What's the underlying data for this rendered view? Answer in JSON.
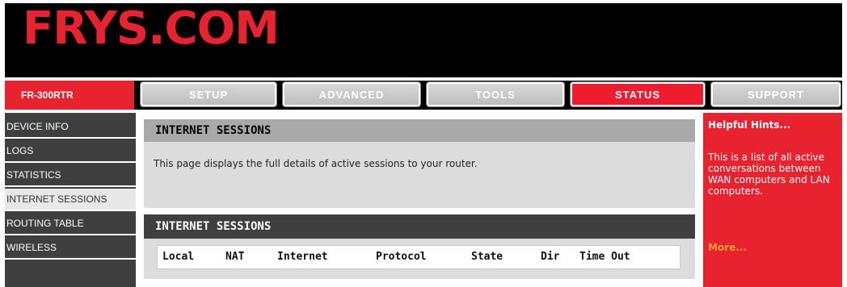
{
  "header": {
    "logo": "FRYS.COM"
  },
  "model": "FR-300RTR",
  "nav": {
    "tabs": [
      {
        "label": "SETUP",
        "active": false
      },
      {
        "label": "ADVANCED",
        "active": false
      },
      {
        "label": "TOOLS",
        "active": false
      },
      {
        "label": "STATUS",
        "active": true
      },
      {
        "label": "SUPPORT",
        "active": false
      }
    ]
  },
  "sidebar": {
    "items": [
      {
        "label": "DEVICE INFO",
        "active": false
      },
      {
        "label": "LOGS",
        "active": false
      },
      {
        "label": "STATISTICS",
        "active": false
      },
      {
        "label": "INTERNET SESSIONS",
        "active": true
      },
      {
        "label": "ROUTING TABLE",
        "active": false
      },
      {
        "label": "WIRELESS",
        "active": false
      }
    ]
  },
  "main": {
    "section1": {
      "title": "INTERNET SESSIONS",
      "description": "This page displays the full details of active sessions to your router."
    },
    "section2": {
      "title": "INTERNET SESSIONS",
      "columns": [
        "Local",
        "NAT",
        "Internet",
        "Protocol",
        "State",
        "Dir",
        "Time Out"
      ]
    }
  },
  "hints": {
    "title": "Helpful Hints...",
    "text": "This is a list of all active conversations between WAN computers and LAN computers.",
    "more": "More..."
  },
  "colors": {
    "brand_red": "#e8232f",
    "sidebar_bg": "#3f3f3f",
    "more_link": "#f2a23a"
  }
}
